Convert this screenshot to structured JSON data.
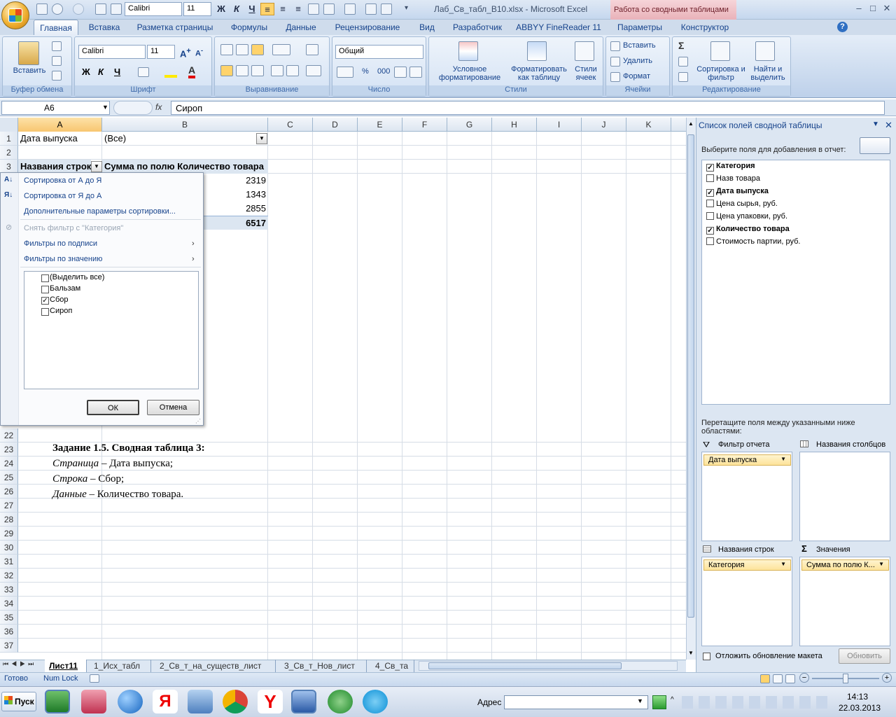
{
  "window": {
    "file_title": "Лаб_Св_табл_В10.xlsx - Microsoft Excel",
    "context_title": "Работа со сводными таблицами",
    "qat_font": "Calibri",
    "qat_size": "11"
  },
  "ribbon_tabs": [
    "Главная",
    "Вставка",
    "Разметка страницы",
    "Формулы",
    "Данные",
    "Рецензирование",
    "Вид",
    "Разработчик",
    "ABBYY FineReader 11",
    "Параметры",
    "Конструктор"
  ],
  "ribbon": {
    "paste": "Вставить",
    "font_name": "Calibri",
    "font_size": "11",
    "number_format": "Общий",
    "cond_format": "Условное форматирование",
    "format_table": "Форматировать как таблицу",
    "cell_styles": "Стили ячеек",
    "insert": "Вставить",
    "delete": "Удалить",
    "format": "Формат",
    "sort_filter": "Сортировка и фильтр",
    "find_select": "Найти и выделить",
    "groups": {
      "clipboard": "Буфер обмена",
      "font": "Шрифт",
      "alignment": "Выравнивание",
      "number": "Число",
      "styles": "Стили",
      "cells": "Ячейки",
      "editing": "Редактирование"
    }
  },
  "formula_bar": {
    "name_box": "A6",
    "fx": "fx",
    "value": "Сироп"
  },
  "columns": [
    "A",
    "B",
    "C",
    "D",
    "E",
    "F",
    "G",
    "H",
    "I",
    "J",
    "K"
  ],
  "rows": {
    "top": [
      "1",
      "2",
      "3"
    ],
    "bottom": [
      "22",
      "23",
      "24",
      "25",
      "26",
      "27",
      "28",
      "29",
      "30",
      "31",
      "32",
      "33",
      "34",
      "35",
      "36",
      "37"
    ]
  },
  "cells": {
    "a1": "Дата выпуска",
    "b1": "(Все)",
    "a3": "Названия строк",
    "b3": "Сумма по полю Количество товара",
    "values": [
      "2319",
      "1343",
      "2855"
    ],
    "total": "6517",
    "task_title": "Задание 1.5. Сводная таблица 3:",
    "task_lines": [
      {
        "label": "Страница",
        "text": " – Дата выпуска;"
      },
      {
        "label": "Строка",
        "text": " – Сбор;"
      },
      {
        "label": "Данные",
        "text": " – Количество товара."
      }
    ]
  },
  "filter_menu": {
    "sort_az": "Сортировка от А до Я",
    "sort_za": "Сортировка от Я до А",
    "more_sort": "Дополнительные параметры сортировки...",
    "clear_filter": "Снять фильтр с \"Категория\"",
    "label_filters": "Фильтры по подписи",
    "value_filters": "Фильтры по значению",
    "items": [
      {
        "label": "(Выделить все)",
        "checked": false
      },
      {
        "label": "Бальзам",
        "checked": false
      },
      {
        "label": "Сбор",
        "checked": true
      },
      {
        "label": "Сироп",
        "checked": false
      }
    ],
    "ok": "ОК",
    "cancel": "Отмена"
  },
  "sheet_tabs": [
    "Лист11",
    "1_Исх_табл",
    "2_Св_т_на_существ_лист",
    "3_Св_т_Нов_лист",
    "4_Св_та"
  ],
  "status": {
    "ready": "Готово",
    "numlock": "Num Lock"
  },
  "pivot_pane": {
    "title": "Список полей сводной таблицы",
    "choose": "Выберите поля для добавления в отчет:",
    "fields": [
      {
        "label": "Категория",
        "checked": true
      },
      {
        "label": "Назв товара",
        "checked": false
      },
      {
        "label": "Дата выпуска",
        "checked": true
      },
      {
        "label": "Цена сырья, руб.",
        "checked": false
      },
      {
        "label": "Цена упаковки, руб.",
        "checked": false
      },
      {
        "label": "Количество товара",
        "checked": true
      },
      {
        "label": "Стоимость партии, руб.",
        "checked": false
      }
    ],
    "drag_hint": "Перетащите поля между указанными ниже областями:",
    "report_filter": "Фильтр отчета",
    "col_labels": "Названия столбцов",
    "row_labels": "Названия строк",
    "values": "Значения",
    "filter_chip": "Дата выпуска",
    "row_chip": "Категория",
    "value_chip": "Сумма по полю К...",
    "defer": "Отложить обновление макета",
    "update": "Обновить"
  },
  "taskbar": {
    "start": "Пуск",
    "address": "Адрес",
    "time": "14:13",
    "date": "22.03.2013"
  }
}
